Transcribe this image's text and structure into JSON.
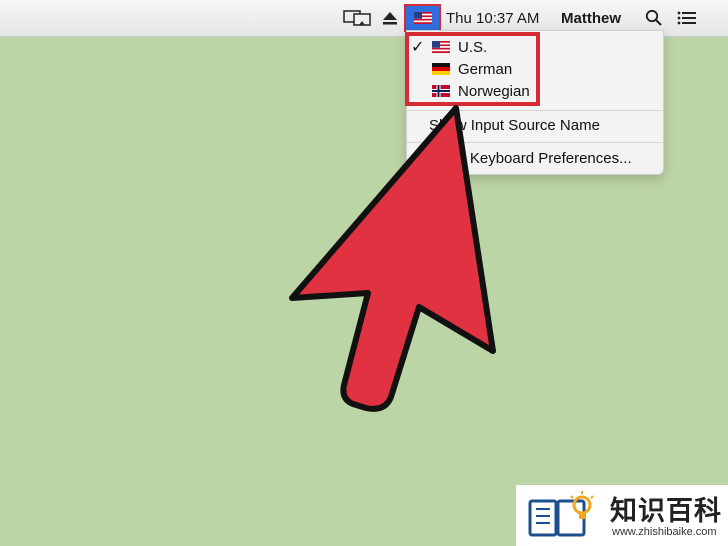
{
  "menubar": {
    "display_icon": "airplay-display-icon",
    "eject_icon": "eject-icon",
    "input_source_icon": "us-flag-icon",
    "clock": "Thu 10:37 AM",
    "user": "Matthew",
    "search_icon": "spotlight-search-icon",
    "notifications_icon": "notification-center-icon"
  },
  "dropdown": {
    "items": [
      {
        "label": "U.S.",
        "flag": "us-flag-icon",
        "checked": true
      },
      {
        "label": "German",
        "flag": "german-flag-icon",
        "checked": false
      },
      {
        "label": "Norwegian",
        "flag": "norwegian-flag-icon",
        "checked": false
      }
    ],
    "checkmark": "✓",
    "show_input_source_name": "Show Input Source Name",
    "open_keyboard_preferences": "Open Keyboard Preferences..."
  },
  "colors": {
    "background": "#bcd5a6",
    "highlight": "#d42b34",
    "arrow_fill": "#e03240",
    "selected_input_bg": "#2f6fe0"
  },
  "watermark": {
    "logo_icon": "book-lightbulb-icon",
    "title": "知识百科",
    "url": "www.zhishibaike.com"
  }
}
